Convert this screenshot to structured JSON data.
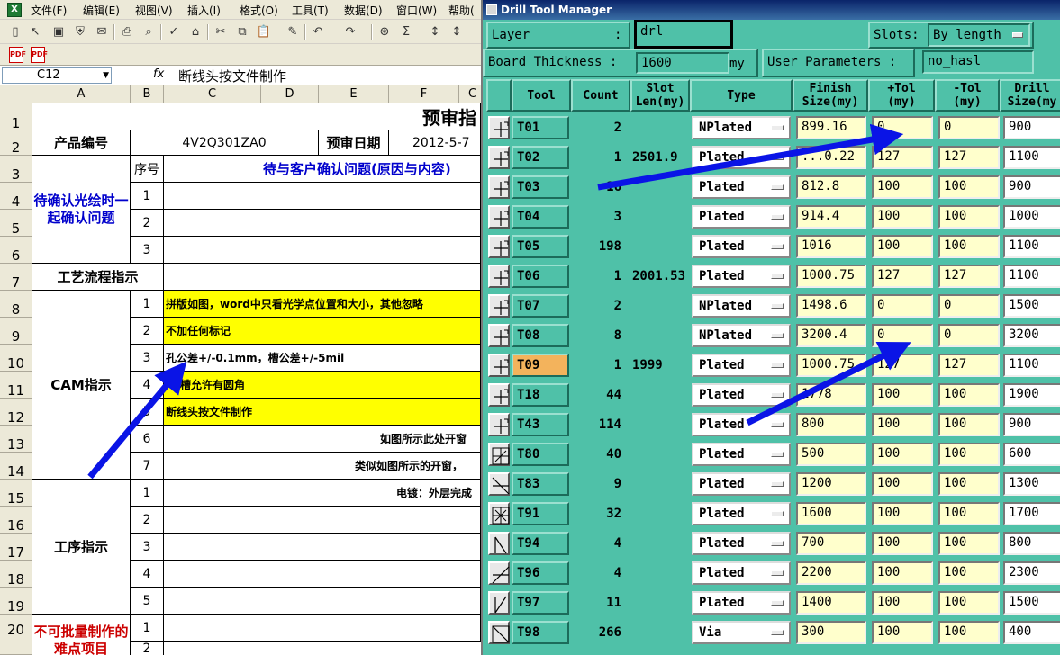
{
  "excel": {
    "menu": [
      "文件(F)",
      "编辑(E)",
      "视图(V)",
      "插入(I)",
      "格式(O)",
      "工具(T)",
      "数据(D)",
      "窗口(W)",
      "帮助("
    ],
    "name_box": "C12",
    "fx": "fx",
    "formula": "断线头按文件制作",
    "columns": [
      "A",
      "B",
      "C",
      "D",
      "E",
      "F",
      "C"
    ],
    "rows": [
      "1",
      "2",
      "3",
      "4",
      "5",
      "6",
      "7",
      "8",
      "9",
      "10",
      "11",
      "12",
      "13",
      "14",
      "15",
      "16",
      "17",
      "18",
      "19",
      "20"
    ],
    "title": "预审指",
    "product_label": "产品编号",
    "product_value": "4V2Q301ZA0",
    "date_label": "预审日期",
    "date_value": "2012-5-7",
    "seq_label": "序号",
    "confirm_header": "待与客户确认问题(原因与内容)",
    "confirm_group": "待确认光绘时一起确认问题",
    "confirm_nums": [
      "1",
      "2",
      "3"
    ],
    "process_label": "工艺流程指示",
    "cam_label": "CAM指示",
    "cam_nums": [
      "1",
      "2",
      "3",
      "4",
      "5",
      "6",
      "7"
    ],
    "cam_items": [
      "拼版如图，word中只看光学点位置和大小，其他忽略",
      "不加任何标记",
      "孔公差+/-0.1mm，槽公差+/-5mil",
      "槽允许有圆角",
      "断线头按文件制作",
      "如图所示此处开窗",
      "类似如图所示的开窗，"
    ],
    "proc_label": "工序指示",
    "proc_nums": [
      "1",
      "2",
      "3",
      "4",
      "5"
    ],
    "proc_items": [
      "电镀：外层完成",
      "",
      "",
      "",
      ""
    ],
    "hard_label": "不可批量制作的难点项目",
    "hard_nums": [
      "1",
      "2"
    ]
  },
  "dtm": {
    "title": "Drill Tool Manager",
    "layer_label": "Layer",
    "layer_colon": ":",
    "layer_value": "drl",
    "slots_label": "Slots:",
    "slots_value": "By length",
    "thickness_label": "Board Thickness :",
    "thickness_value": "1600",
    "thickness_unit": "my",
    "user_params_label": "User Parameters :",
    "user_params_value": "no_hasl",
    "headers": {
      "tool": "Tool",
      "count": "Count",
      "slot_len": "Slot\nLen(my)",
      "type": "Type",
      "finish": "Finish\nSize(my)",
      "ptol": "+Tol\n(my)",
      "mtol": "-Tol\n(my)",
      "drill": "Drill\nSize(my"
    },
    "tools": [
      {
        "tool": "T01",
        "count": "2",
        "slot": "",
        "type": "NPlated",
        "finish": "899.16",
        "ptol": "0",
        "mtol": "0",
        "drill": "900",
        "icon": "plus"
      },
      {
        "tool": "T02",
        "count": "1",
        "slot": "2501.9",
        "type": "Plated",
        "finish": "...0.22",
        "ptol": "127",
        "mtol": "127",
        "drill": "1100",
        "icon": "plus"
      },
      {
        "tool": "T03",
        "count": "16",
        "slot": "",
        "type": "Plated",
        "finish": "812.8",
        "ptol": "100",
        "mtol": "100",
        "drill": "900",
        "icon": "plus"
      },
      {
        "tool": "T04",
        "count": "3",
        "slot": "",
        "type": "Plated",
        "finish": "914.4",
        "ptol": "100",
        "mtol": "100",
        "drill": "1000",
        "icon": "plus"
      },
      {
        "tool": "T05",
        "count": "198",
        "slot": "",
        "type": "Plated",
        "finish": "1016",
        "ptol": "100",
        "mtol": "100",
        "drill": "1100",
        "icon": "plus"
      },
      {
        "tool": "T06",
        "count": "1",
        "slot": "2001.53",
        "type": "Plated",
        "finish": "1000.75",
        "ptol": "127",
        "mtol": "127",
        "drill": "1100",
        "icon": "plus"
      },
      {
        "tool": "T07",
        "count": "2",
        "slot": "",
        "type": "NPlated",
        "finish": "1498.6",
        "ptol": "0",
        "mtol": "0",
        "drill": "1500",
        "icon": "plus"
      },
      {
        "tool": "T08",
        "count": "8",
        "slot": "",
        "type": "NPlated",
        "finish": "3200.4",
        "ptol": "0",
        "mtol": "0",
        "drill": "3200",
        "icon": "plus"
      },
      {
        "tool": "T09",
        "count": "1",
        "slot": "1999",
        "type": "Plated",
        "finish": "1000.75",
        "ptol": "127",
        "mtol": "127",
        "drill": "1100",
        "icon": "plus",
        "selected": true
      },
      {
        "tool": "T18",
        "count": "44",
        "slot": "",
        "type": "Plated",
        "finish": "1778",
        "ptol": "100",
        "mtol": "100",
        "drill": "1900",
        "icon": "plus"
      },
      {
        "tool": "T43",
        "count": "114",
        "slot": "",
        "type": "Plated",
        "finish": "800",
        "ptol": "100",
        "mtol": "100",
        "drill": "900",
        "icon": "plus"
      },
      {
        "tool": "T80",
        "count": "40",
        "slot": "",
        "type": "Plated",
        "finish": "500",
        "ptol": "100",
        "mtol": "100",
        "drill": "600",
        "icon": "plusbox"
      },
      {
        "tool": "T83",
        "count": "9",
        "slot": "",
        "type": "Plated",
        "finish": "1200",
        "ptol": "100",
        "mtol": "100",
        "drill": "1300",
        "icon": "diag-down"
      },
      {
        "tool": "T91",
        "count": "32",
        "slot": "",
        "type": "Plated",
        "finish": "1600",
        "ptol": "100",
        "mtol": "100",
        "drill": "1700",
        "icon": "grid"
      },
      {
        "tool": "T94",
        "count": "4",
        "slot": "",
        "type": "Plated",
        "finish": "700",
        "ptol": "100",
        "mtol": "100",
        "drill": "800",
        "icon": "diag-steep"
      },
      {
        "tool": "T96",
        "count": "4",
        "slot": "",
        "type": "Plated",
        "finish": "2200",
        "ptol": "100",
        "mtol": "100",
        "drill": "2300",
        "icon": "diag-up"
      },
      {
        "tool": "T97",
        "count": "11",
        "slot": "",
        "type": "Plated",
        "finish": "1400",
        "ptol": "100",
        "mtol": "100",
        "drill": "1500",
        "icon": "diag-up-steep"
      },
      {
        "tool": "T98",
        "count": "266",
        "slot": "",
        "type": "Via",
        "finish": "300",
        "ptol": "100",
        "mtol": "100",
        "drill": "400",
        "icon": "box-diag"
      }
    ]
  },
  "colors": {
    "accent": "#4fc1a8",
    "highlight": "#ffff00",
    "selected_tool": "#f3b35c",
    "arrow": "#0a14e6"
  }
}
